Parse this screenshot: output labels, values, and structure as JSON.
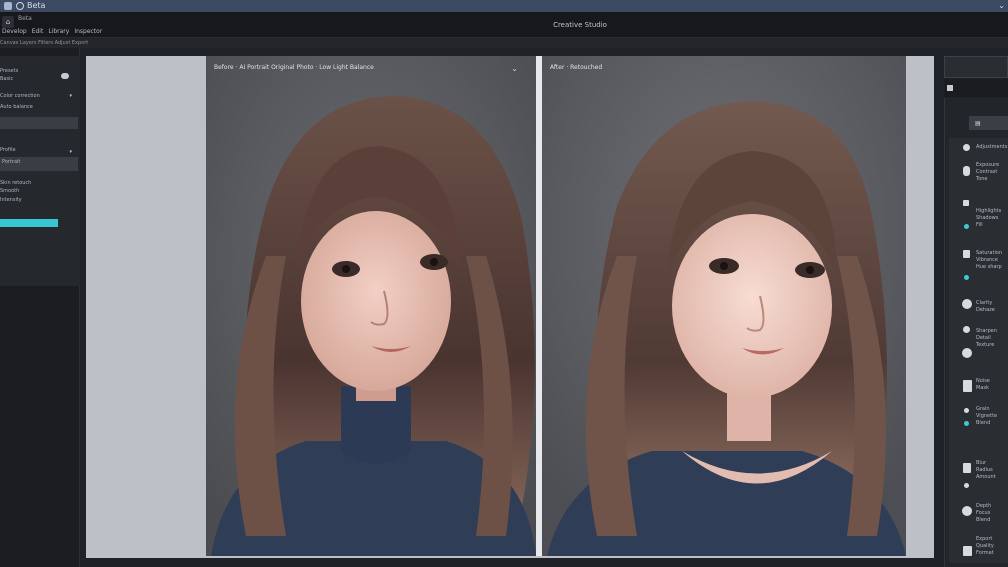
{
  "titlebar": {
    "title": "Beta",
    "chevron": "⌄"
  },
  "menubar": {
    "logo": "⌂",
    "version": "Beta",
    "items": [
      "Develop",
      "Edit",
      "Library",
      "Inspector"
    ],
    "center_title": "Creative Studio"
  },
  "subbar": {
    "text": "Canvas  Layers  Filters  Adjust  Export"
  },
  "sidebar": {
    "section1": "Presets",
    "section1_sub": "Basic",
    "section2": "Color correction",
    "section2_sub": "Auto balance",
    "section3": "Profile",
    "section3_sub": "Portrait",
    "section4": "Skin retouch",
    "section4_sub": "Smooth",
    "section5": "Intensity",
    "slider_value": 0.74,
    "accent_color": "#39c7d1",
    "collapse_icon": "chevron-down-icon",
    "cloud_icon": "cloud-icon"
  },
  "viewer_left": {
    "label": "Before · AI Portrait Original Photo · Low Light Balance",
    "chevron": "⌄"
  },
  "viewer_right": {
    "label": "After · Retouched"
  },
  "right_panel": {
    "tool_icon": "▤",
    "items": [
      "Adjustments",
      "Exposure\nContrast\nTone",
      "Highlights\nShadows\nFill",
      "Saturation\nVibrance\nHue sharp",
      "Clarity\nDehaze",
      "Sharpen\nDetail\nTexture",
      "Noise\nMask",
      "Grain\nVignette\nBlend",
      "Blur\nRadius\nAmount",
      "Depth\nFocus\nBlend",
      "Export\nQuality\nFormat"
    ]
  }
}
